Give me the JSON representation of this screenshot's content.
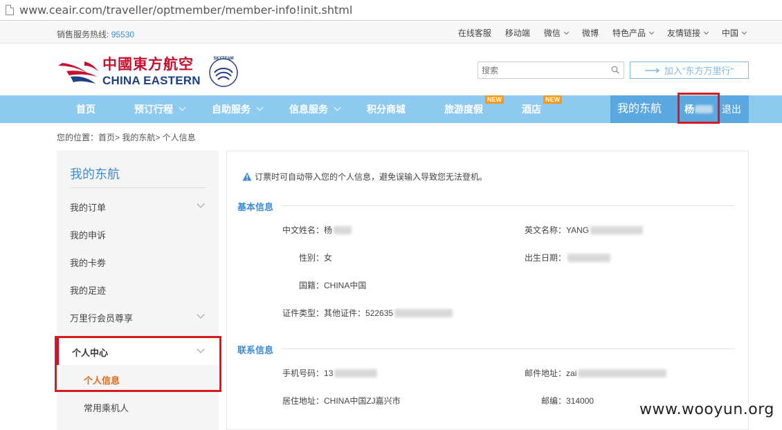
{
  "browser": {
    "url": "www.ceair.com/traveller/optmember/member-info!init.shtml"
  },
  "topbar": {
    "hotline_label": "销售服务热线:",
    "hotline_number": "95530",
    "links": [
      "在线客服",
      "移动端",
      "微信",
      "微博",
      "特色产品",
      "友情链接",
      "中国"
    ]
  },
  "header": {
    "logo_cn": "中國東方航空",
    "logo_en": "CHINA EASTERN",
    "skyteam": "SKYTEAM",
    "search_placeholder": "搜索",
    "join_label": "加入\"东方万里行\""
  },
  "nav": {
    "items": [
      "首页",
      "预订行程",
      "自助服务",
      "信息服务",
      "积分商城",
      "旅游度假",
      "酒店"
    ],
    "new_badge": "NEW",
    "my_title": "我的东航",
    "user_name": "杨",
    "logout": "退出"
  },
  "breadcrumb": "您的位置：首页> 我的东航> 个人信息",
  "sidebar": {
    "title": "我的东航",
    "items": [
      "我的订单",
      "我的申诉",
      "我的卡劵",
      "我的足迹",
      "万里行会员尊享",
      "个人中心"
    ],
    "sub_items": [
      "个人信息",
      "常用乘机人"
    ]
  },
  "content": {
    "notice": "订票时可自动带入您的个人信息，避免误输入导致您无法登机。",
    "basic_title": "基本信息",
    "contact_title": "联系信息",
    "basic": {
      "cn_name_label": "中文姓名：",
      "cn_name_value": "杨",
      "en_name_label": "英文名称：",
      "en_name_value": "YANG",
      "gender_label": "性别：",
      "gender_value": "女",
      "birth_label": "出生日期：",
      "nation_label": "国籍：",
      "nation_value": "CHINA中国",
      "id_label": "证件类型：",
      "id_value": "其他证件：522635"
    },
    "contact": {
      "phone_label": "手机号码：",
      "phone_value": "13",
      "email_label": "邮件地址：",
      "email_value": "zai",
      "address_label": "居住地址：",
      "address_value": "CHINA中国ZJ嘉兴市",
      "zip_label": "邮编：",
      "zip_value": "314000"
    }
  },
  "watermark": "www.wooyun.org",
  "colors": {
    "nav_bg": "#8ecaf0",
    "nav_my_bg": "#5ba8e0",
    "brand_red": "#c8102e",
    "brand_blue": "#1d3f87",
    "link_blue": "#3d8bd5",
    "highlight_box": "#d71920"
  }
}
